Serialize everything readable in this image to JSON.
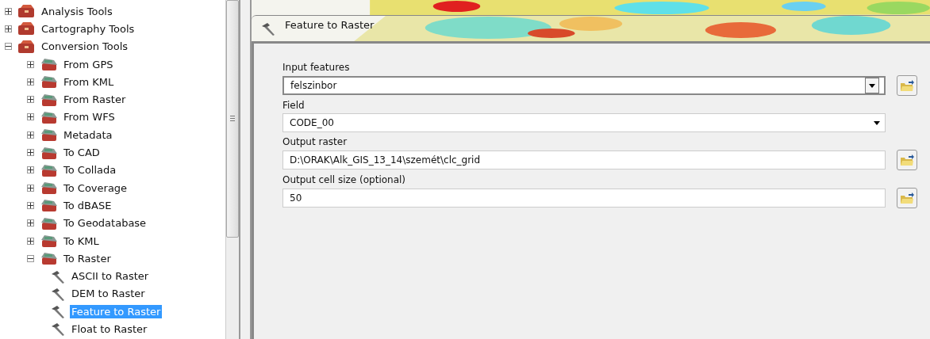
{
  "tree": [
    {
      "label": "Analysis Tools",
      "kind": "toolbox",
      "expanded": false,
      "selected": false
    },
    {
      "label": "Cartography Tools",
      "kind": "toolbox",
      "expanded": false,
      "selected": false
    },
    {
      "label": "Conversion Tools",
      "kind": "toolbox",
      "expanded": true,
      "selected": false,
      "children": [
        {
          "label": "From GPS",
          "kind": "toolset",
          "expanded": false,
          "selected": false
        },
        {
          "label": "From KML",
          "kind": "toolset",
          "expanded": false,
          "selected": false
        },
        {
          "label": "From Raster",
          "kind": "toolset",
          "expanded": false,
          "selected": false
        },
        {
          "label": "From WFS",
          "kind": "toolset",
          "expanded": false,
          "selected": false
        },
        {
          "label": "Metadata",
          "kind": "toolset",
          "expanded": false,
          "selected": false
        },
        {
          "label": "To CAD",
          "kind": "toolset",
          "expanded": false,
          "selected": false
        },
        {
          "label": "To Collada",
          "kind": "toolset",
          "expanded": false,
          "selected": false
        },
        {
          "label": "To Coverage",
          "kind": "toolset",
          "expanded": false,
          "selected": false
        },
        {
          "label": "To dBASE",
          "kind": "toolset",
          "expanded": false,
          "selected": false
        },
        {
          "label": "To Geodatabase",
          "kind": "toolset",
          "expanded": false,
          "selected": false
        },
        {
          "label": "To KML",
          "kind": "toolset",
          "expanded": false,
          "selected": false
        },
        {
          "label": "To Raster",
          "kind": "toolset",
          "expanded": true,
          "selected": false,
          "children": [
            {
              "label": "ASCII to Raster",
              "kind": "tool",
              "selected": false
            },
            {
              "label": "DEM to Raster",
              "kind": "tool",
              "selected": false
            },
            {
              "label": "Feature to Raster",
              "kind": "tool",
              "selected": true
            },
            {
              "label": "Float to Raster",
              "kind": "tool",
              "selected": false
            }
          ]
        }
      ]
    }
  ],
  "dialog": {
    "title": "Feature to Raster",
    "fields": [
      {
        "label": "Input features",
        "value": "felszinbor",
        "kind": "combo",
        "browse": true
      },
      {
        "label": "Field",
        "value": "CODE_00",
        "kind": "select",
        "browse": false
      },
      {
        "label": "Output raster",
        "value": "D:\\ORAK\\Alk_GIS_13_14\\szemét\\clc_grid",
        "kind": "text",
        "browse": true
      },
      {
        "label": "Output cell size (optional)",
        "value": "50",
        "kind": "text",
        "browse": true
      }
    ]
  }
}
